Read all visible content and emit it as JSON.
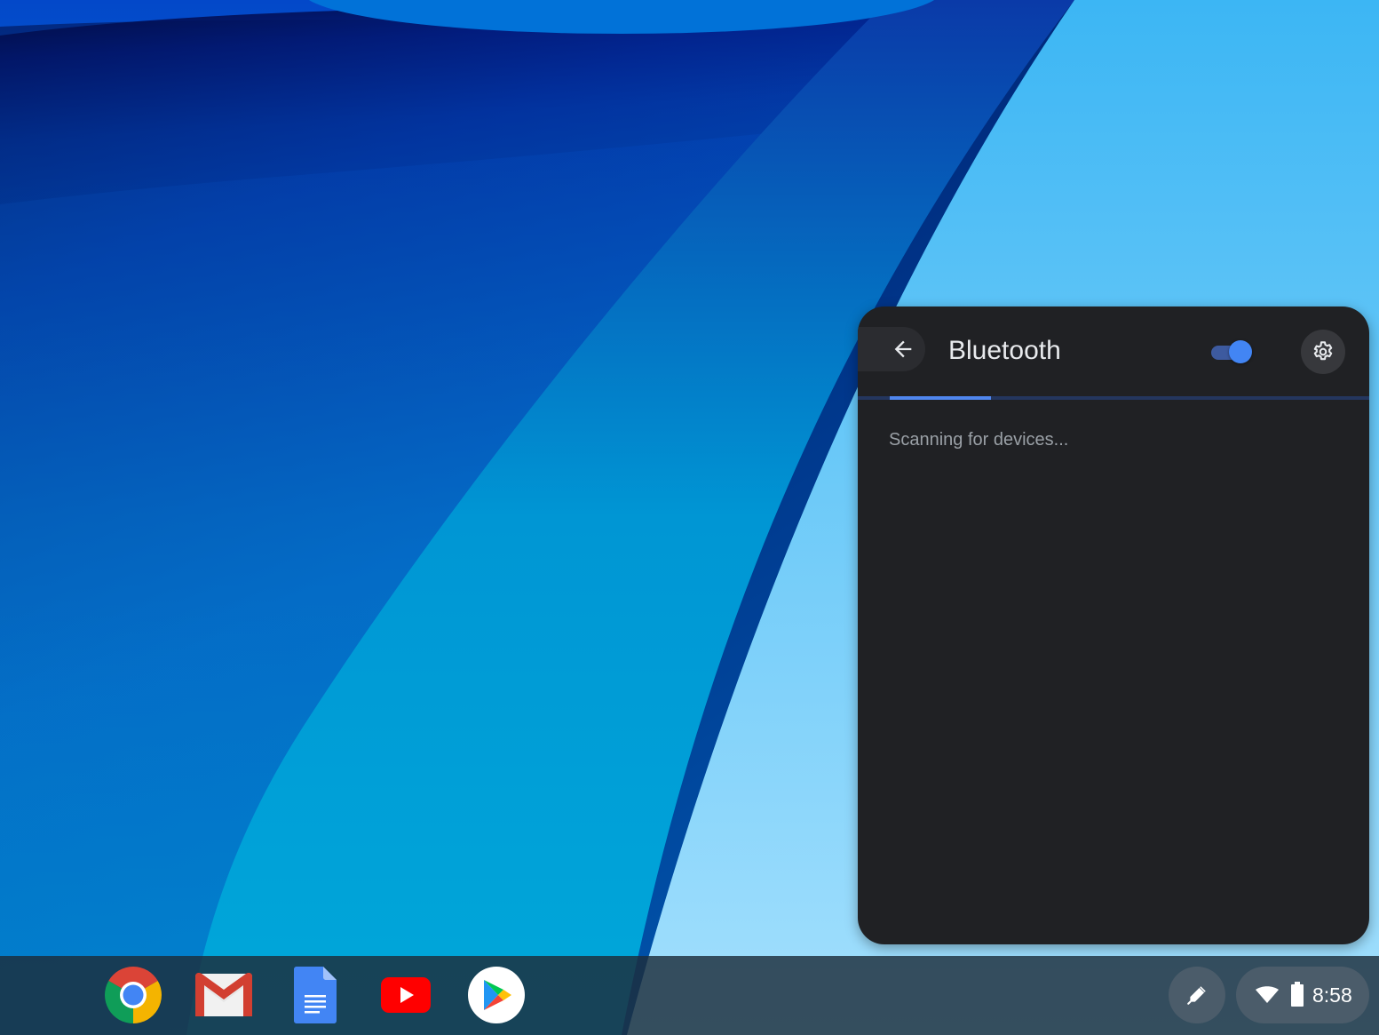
{
  "bluetooth_panel": {
    "title": "Bluetooth",
    "back_icon": "arrow-back-icon",
    "settings_icon": "gear-icon",
    "toggle_on": true,
    "status_text": "Scanning for devices...",
    "colors": {
      "panel_bg": "#202124",
      "accent": "#4285f4",
      "title_text": "#e8eaed",
      "status_text": "#9aa0a6"
    }
  },
  "shelf": {
    "apps": [
      {
        "name": "Chrome",
        "icon": "chrome-icon"
      },
      {
        "name": "Gmail",
        "icon": "gmail-icon"
      },
      {
        "name": "Docs",
        "icon": "docs-icon"
      },
      {
        "name": "YouTube",
        "icon": "youtube-icon"
      },
      {
        "name": "Play Store",
        "icon": "play-store-icon"
      }
    ],
    "stylus_icon": "stylus-icon"
  },
  "status_area": {
    "wifi_icon": "wifi-icon",
    "battery_icon": "battery-icon",
    "time": "8:58"
  }
}
